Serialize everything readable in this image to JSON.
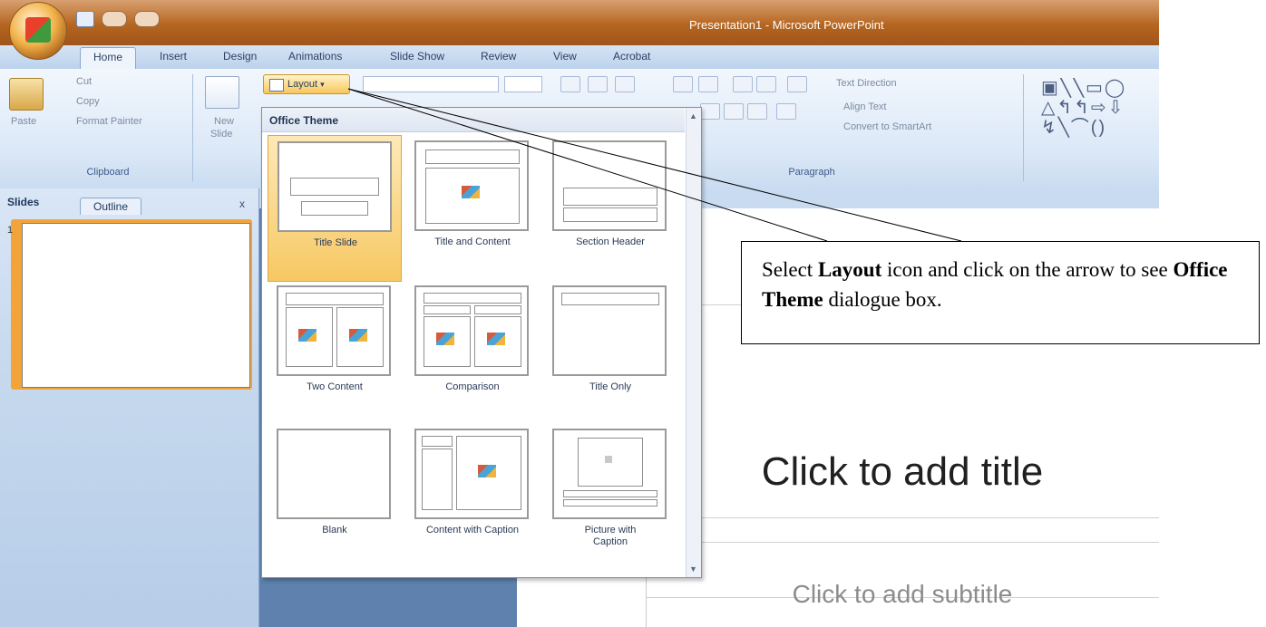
{
  "window": {
    "title": "Presentation1 - Microsoft PowerPoint"
  },
  "ribbon": {
    "tabs": [
      {
        "label": "Home",
        "active": true
      },
      {
        "label": "Insert"
      },
      {
        "label": "Design"
      },
      {
        "label": "Animations"
      },
      {
        "label": "Slide Show"
      },
      {
        "label": "Review"
      },
      {
        "label": "View"
      },
      {
        "label": "Acrobat"
      }
    ],
    "clipboard": {
      "paste": "Paste",
      "cut": "Cut",
      "copy": "Copy",
      "format_painter": "Format Painter",
      "group_label": "Clipboard"
    },
    "slides": {
      "new_slide_line1": "New",
      "new_slide_line2": "Slide",
      "layout": "Layout"
    },
    "paragraph": {
      "text_direction": "Text Direction",
      "align_text": "Align Text",
      "convert_smartart": "Convert to SmartArt",
      "group_label": "Paragraph"
    }
  },
  "left_panel": {
    "tab_slides": "Slides",
    "tab_outline": "Outline",
    "close": "x",
    "slide_number": "1"
  },
  "layout_gallery": {
    "header": "Office Theme",
    "items": [
      {
        "label": "Title Slide",
        "selected": true
      },
      {
        "label": "Title and Content"
      },
      {
        "label": "Section Header"
      },
      {
        "label": "Two Content"
      },
      {
        "label": "Comparison"
      },
      {
        "label": "Title Only"
      },
      {
        "label": "Blank"
      },
      {
        "label": "Content with Caption"
      },
      {
        "label": "Picture with Caption"
      }
    ]
  },
  "slide": {
    "title_placeholder": "Click to add title",
    "subtitle_placeholder": "Click to add subtitle"
  },
  "callout": {
    "part1": "Select ",
    "bold1": "Layout",
    "part2": " icon and click on the arrow to see ",
    "bold2": "Office Theme",
    "part3": " dialogue box."
  }
}
